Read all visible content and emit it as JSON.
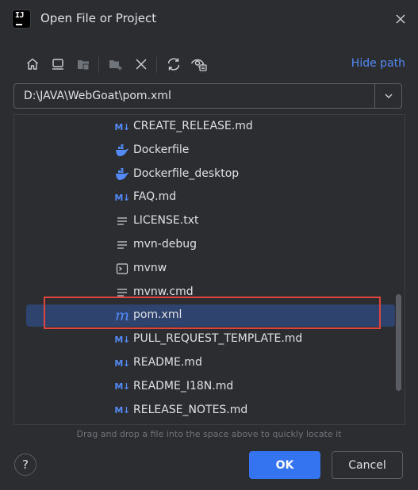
{
  "window": {
    "title": "Open File or Project",
    "app_icon_text": "IJ"
  },
  "toolbar": {
    "icons": [
      "home-icon",
      "desktop-icon",
      "project-folder-icon",
      "new-folder-icon",
      "delete-icon",
      "refresh-icon",
      "show-hidden-icon"
    ],
    "hide_path_label": "Hide path"
  },
  "path_field": {
    "value": "D:\\JAVA\\WebGoat\\pom.xml"
  },
  "tree": {
    "items": [
      {
        "label": "CREATE_RELEASE.md",
        "icon": "markdown-icon"
      },
      {
        "label": "Dockerfile",
        "icon": "docker-icon"
      },
      {
        "label": "Dockerfile_desktop",
        "icon": "docker-icon"
      },
      {
        "label": "FAQ.md",
        "icon": "markdown-icon"
      },
      {
        "label": "LICENSE.txt",
        "icon": "text-file-icon"
      },
      {
        "label": "mvn-debug",
        "icon": "text-file-icon"
      },
      {
        "label": "mvnw",
        "icon": "terminal-icon"
      },
      {
        "label": "mvnw.cmd",
        "icon": "text-file-icon"
      },
      {
        "label": "pom.xml",
        "icon": "maven-icon",
        "selected": true
      },
      {
        "label": "PULL_REQUEST_TEMPLATE.md",
        "icon": "markdown-icon"
      },
      {
        "label": "README.md",
        "icon": "markdown-icon"
      },
      {
        "label": "README_I18N.md",
        "icon": "markdown-icon"
      },
      {
        "label": "RELEASE_NOTES.md",
        "icon": "markdown-icon"
      }
    ],
    "markdown_icon_text": "M↓",
    "maven_icon_text": "m"
  },
  "hint": "Drag and drop a file into the space above to quickly locate it",
  "footer": {
    "help_label": "?",
    "ok_label": "OK",
    "cancel_label": "Cancel"
  },
  "colors": {
    "accent": "#3574f0",
    "link": "#548af7",
    "selection": "#2e436e",
    "highlight_box": "#e0443e",
    "background": "#2b2d30"
  }
}
